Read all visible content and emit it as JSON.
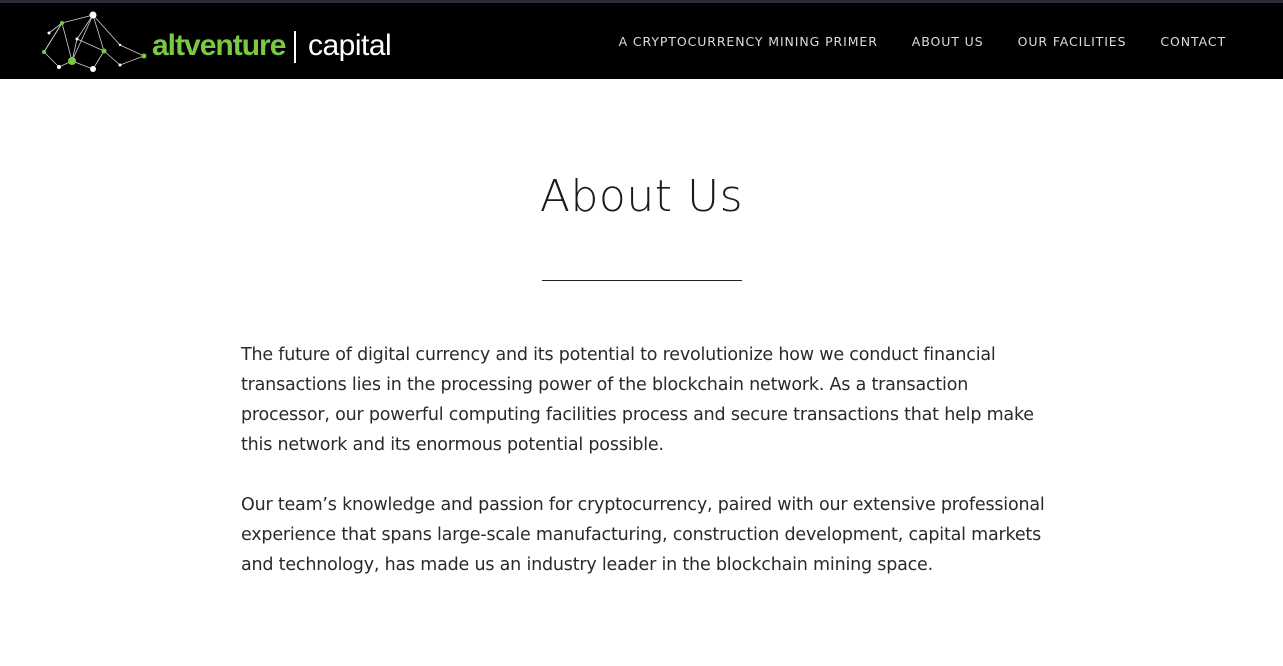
{
  "header": {
    "logo": {
      "word": "altventure",
      "sub": "capital",
      "icon": "network-nodes-logo-icon",
      "accent_color": "#7ac943"
    },
    "nav": [
      {
        "label": "A CRYPTOCURRENCY MINING PRIMER",
        "active": false
      },
      {
        "label": "ABOUT US",
        "active": true
      },
      {
        "label": "OUR FACILITIES",
        "active": false
      },
      {
        "label": "CONTACT",
        "active": false
      }
    ]
  },
  "main": {
    "title": "About Us",
    "paragraphs": [
      "The future of digital currency and its potential to revolutionize how we conduct financial transactions lies in the processing power of the blockchain network. As a transaction processor, our powerful computing facilities process and secure transactions that help make this network and its enormous potential possible.",
      "Our team’s knowledge and passion for cryptocurrency, paired with our extensive professional experience that spans large-scale manufacturing, construction development, capital markets and technology, has made us an industry leader in the blockchain mining space."
    ]
  }
}
